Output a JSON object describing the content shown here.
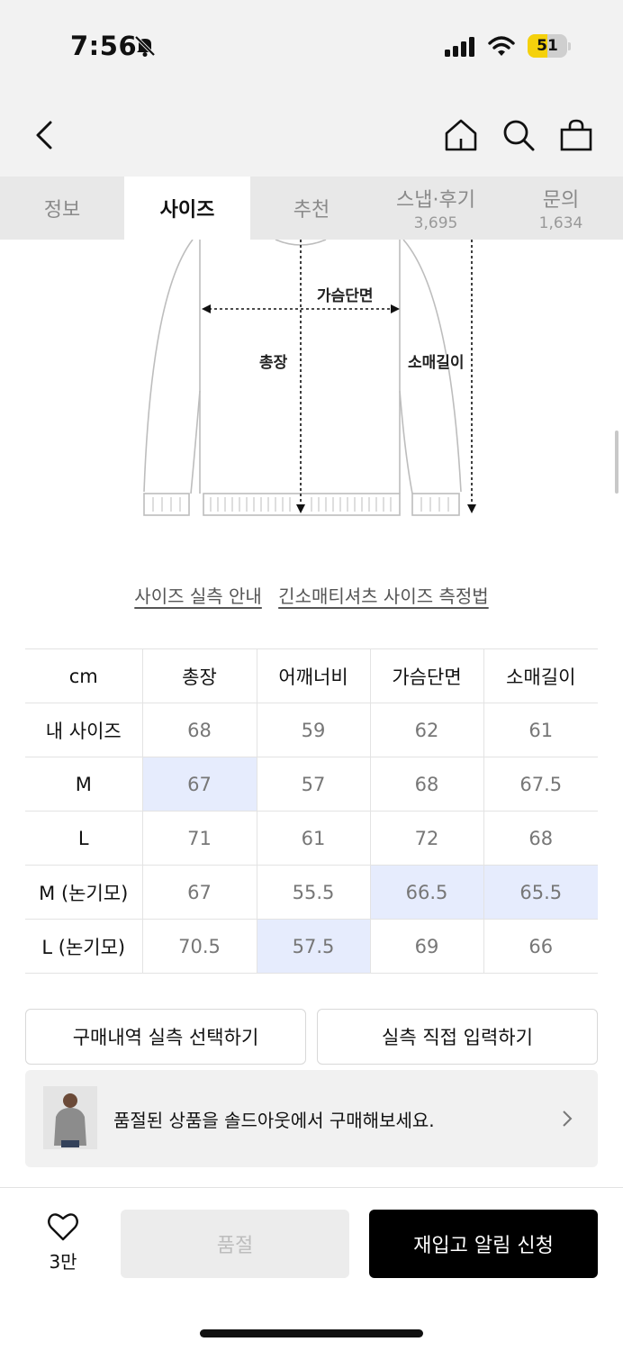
{
  "status": {
    "time": "7:56",
    "battery": "51",
    "battery_level": 0.51
  },
  "header": {
    "back": "back-icon",
    "home": "home-icon",
    "search": "search-icon",
    "cart": "shopping-bag-icon"
  },
  "tabs": [
    {
      "label": "정보",
      "count": ""
    },
    {
      "label": "사이즈",
      "count": ""
    },
    {
      "label": "추천",
      "count": ""
    },
    {
      "label": "스냅·후기",
      "count": "3,695"
    },
    {
      "label": "문의",
      "count": "1,634"
    }
  ],
  "diagram": {
    "chest": "가슴단면",
    "length": "총장",
    "sleeve": "소매길이"
  },
  "links": {
    "guide": "사이즈 실측 안내",
    "method": "긴소매티셔츠 사이즈 측정법"
  },
  "table": {
    "headers": [
      "cm",
      "총장",
      "어깨너비",
      "가슴단면",
      "소매길이"
    ],
    "rows": [
      [
        "내 사이즈",
        "68",
        "59",
        "62",
        "61"
      ],
      [
        "M",
        "67",
        "57",
        "68",
        "67.5"
      ],
      [
        "L",
        "71",
        "61",
        "72",
        "68"
      ],
      [
        "M (논기모)",
        "67",
        "55.5",
        "66.5",
        "65.5"
      ],
      [
        "L (논기모)",
        "70.5",
        "57.5",
        "69",
        "66"
      ]
    ]
  },
  "actions": {
    "select_history": "구매내역 실측 선택하기",
    "direct_input": "실측 직접 입력하기"
  },
  "banner": {
    "text": "품절된 상품을 솔드아웃에서 구매해보세요."
  },
  "bottom": {
    "like_count": "3만",
    "soldout": "품절",
    "restock": "재입고 알림 신청"
  }
}
